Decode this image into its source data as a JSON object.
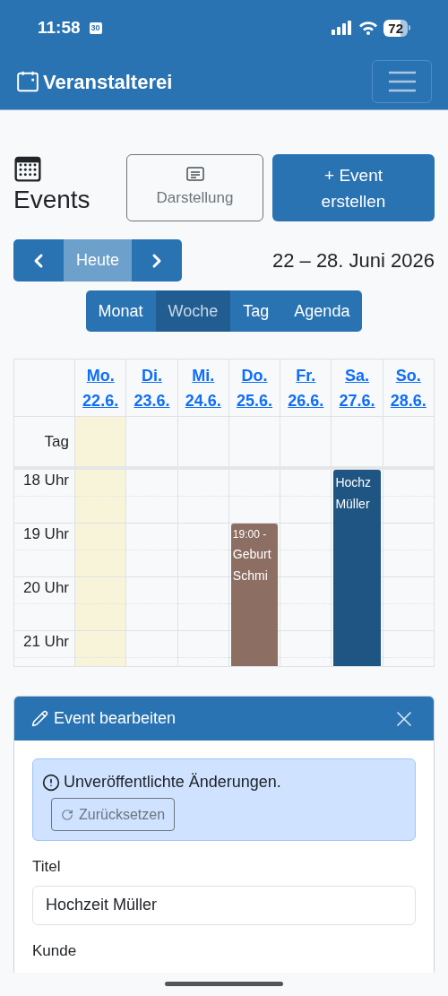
{
  "status_bar": {
    "time": "11:58",
    "date_badge": "30",
    "battery": "72"
  },
  "navbar": {
    "brand": "Veranstalterei"
  },
  "page": {
    "title": "Events",
    "display_button": "Darstellung",
    "create_button": "+ Event erstellen"
  },
  "nav": {
    "today": "Heute",
    "range": "22 – 28. Juni 2026"
  },
  "views": [
    {
      "label": "Monat",
      "selected": false
    },
    {
      "label": "Woche",
      "selected": true
    },
    {
      "label": "Tag",
      "selected": false
    },
    {
      "label": "Agenda",
      "selected": false
    }
  ],
  "calendar": {
    "days": [
      {
        "name": "Mo.",
        "date": "22.6.",
        "today": true
      },
      {
        "name": "Di.",
        "date": "23.6.",
        "today": false
      },
      {
        "name": "Mi.",
        "date": "24.6.",
        "today": false
      },
      {
        "name": "Do.",
        "date": "25.6.",
        "today": false
      },
      {
        "name": "Fr.",
        "date": "26.6.",
        "today": false
      },
      {
        "name": "Sa.",
        "date": "27.6.",
        "today": false
      },
      {
        "name": "So.",
        "date": "28.6.",
        "today": false
      }
    ],
    "allday_label": "Tag",
    "time_rows": [
      {
        "label": "18 Uhr",
        "cells": [
          {},
          {},
          {},
          {},
          {},
          {
            "event": {
              "lines": [
                "Hochz",
                "Müller"
              ],
              "color": "#1f5583"
            }
          },
          {}
        ]
      },
      {
        "label": "19 Uhr",
        "cells": [
          {},
          {},
          {},
          {
            "event": {
              "time": "19:00 -",
              "lines": [
                "Geburt",
                "Schmi"
              ],
              "color": "#8d6e63"
            }
          },
          {},
          {},
          {}
        ]
      },
      {
        "label": "20 Uhr",
        "cells": [
          {},
          {},
          {},
          {},
          {},
          {},
          {}
        ]
      },
      {
        "label": "21 Uhr",
        "cells": [
          {},
          {},
          {},
          {},
          {},
          {},
          {}
        ]
      }
    ]
  },
  "editor": {
    "title": "Event bearbeiten",
    "alert": "Unveröffentlichte Änderungen.",
    "reset_button": "Zurücksetzen",
    "fields": [
      {
        "label": "Titel",
        "value": "Hochzeit Müller"
      },
      {
        "label": "Kunde"
      }
    ]
  }
}
